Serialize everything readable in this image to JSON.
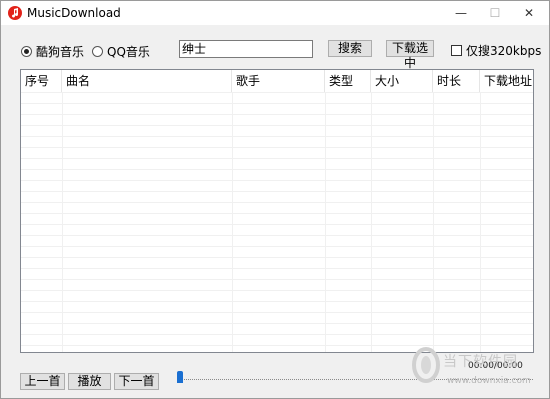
{
  "window": {
    "title": "MusicDownload",
    "minimize": "—",
    "maximize": "☐",
    "close": "✕"
  },
  "sources": [
    {
      "label": "酷狗音乐",
      "checked": true
    },
    {
      "label": "QQ音乐",
      "checked": false
    }
  ],
  "search": {
    "value": "绅士",
    "button": "搜索"
  },
  "download_selected": "下载选中",
  "only_320": {
    "label": "仅搜320kbps",
    "checked": false
  },
  "table": {
    "columns": [
      "序号",
      "曲名",
      "歌手",
      "类型",
      "大小",
      "时长",
      "下载地址"
    ],
    "rows": []
  },
  "player": {
    "prev": "上一首",
    "play": "播放",
    "next": "下一首",
    "time": "00:00/00:00",
    "progress": 0
  },
  "watermark": {
    "text": "当下软件园",
    "url": "www.downxia.com"
  }
}
